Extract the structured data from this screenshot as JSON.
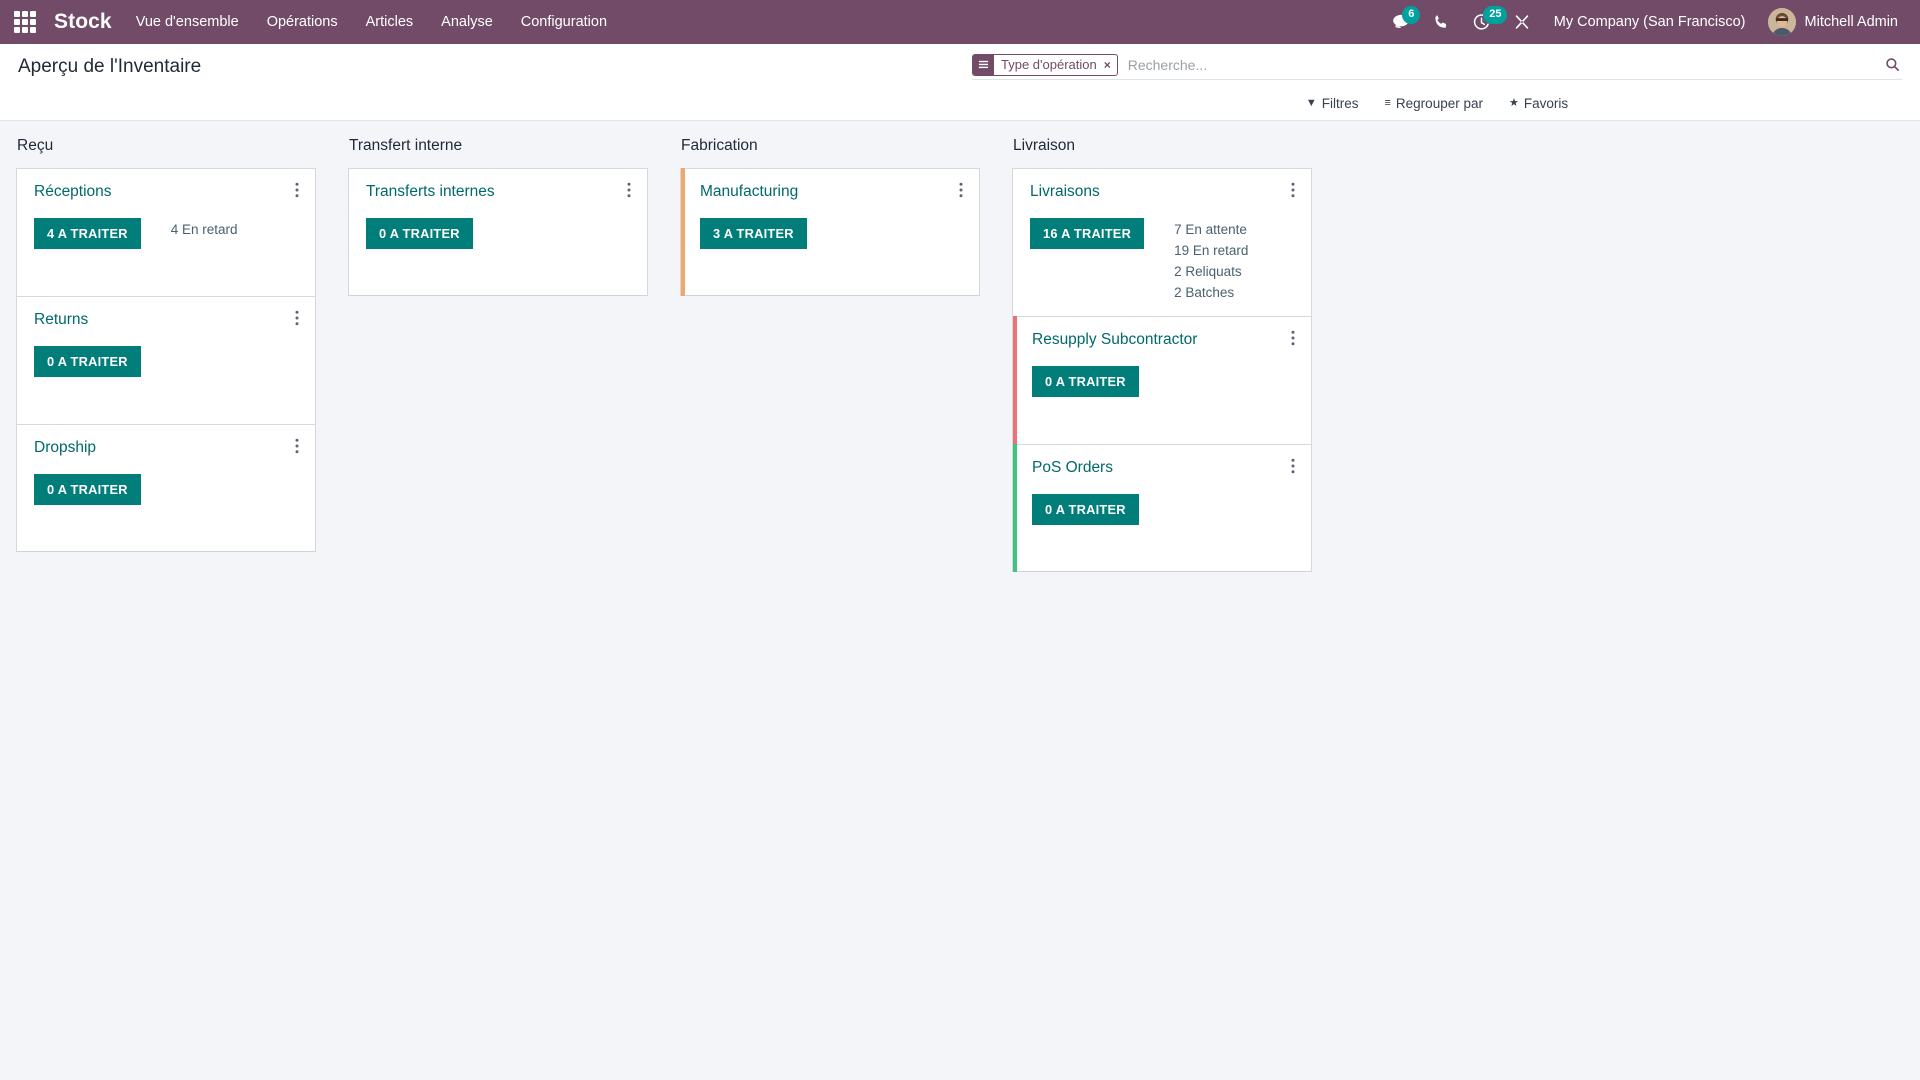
{
  "navbar": {
    "apps_icon": "apps-grid-icon",
    "brand": "Stock",
    "menu": [
      {
        "label": "Vue d'ensemble"
      },
      {
        "label": "Opérations"
      },
      {
        "label": "Articles"
      },
      {
        "label": "Analyse"
      },
      {
        "label": "Configuration"
      }
    ],
    "systray": {
      "messages_icon": "chat-bubble-icon",
      "messages_count": "6",
      "phone_icon": "phone-icon",
      "activities_icon": "clock-icon",
      "activities_count": "25",
      "debug_icon": "tools-icon"
    },
    "company": "My Company (San Francisco)",
    "user": "Mitchell Admin",
    "avatar_icon": "user-avatar"
  },
  "control_panel": {
    "title": "Aperçu de l'Inventaire",
    "search": {
      "facet_icon": "list-bars-icon",
      "facet_label": "Type d'opération",
      "facet_close": "×",
      "placeholder": "Recherche...",
      "value": "",
      "magnifier_icon": "search-icon"
    },
    "filters": [
      {
        "icon": "filter-funnel-icon",
        "glyph": "▼",
        "label": "Filtres"
      },
      {
        "icon": "group-by-icon",
        "glyph": "≡",
        "label": "Regrouper par"
      },
      {
        "icon": "star-icon",
        "glyph": "★",
        "label": "Favoris"
      }
    ]
  },
  "colors": {
    "navbar_purple": "#714b67",
    "button_teal": "#017e79",
    "title_teal": "#00696b",
    "badge_teal": "#00a09d",
    "page_background": "#f4f5f8",
    "accent_orange": "#f0a868",
    "accent_red": "#ef6f77",
    "accent_green": "#3ec47e"
  },
  "kanban": {
    "columns": [
      {
        "title": "Reçu",
        "cards": [
          {
            "title": "Réceptions",
            "menu_icon": "vertical-ellipsis-icon",
            "button": "4 A TRAITER",
            "accent": "",
            "stats": [
              "4 En retard"
            ]
          },
          {
            "title": "Returns",
            "menu_icon": "vertical-ellipsis-icon",
            "button": "0 A TRAITER",
            "accent": "",
            "stats": []
          },
          {
            "title": "Dropship",
            "menu_icon": "vertical-ellipsis-icon",
            "button": "0 A TRAITER",
            "accent": "",
            "stats": []
          }
        ]
      },
      {
        "title": "Transfert interne",
        "cards": [
          {
            "title": "Transferts internes",
            "menu_icon": "vertical-ellipsis-icon",
            "button": "0 A TRAITER",
            "accent": "",
            "stats": []
          }
        ]
      },
      {
        "title": "Fabrication",
        "cards": [
          {
            "title": "Manufacturing",
            "menu_icon": "vertical-ellipsis-icon",
            "button": "3 A TRAITER",
            "accent": "#f0a868",
            "stats": []
          }
        ]
      },
      {
        "title": "Livraison",
        "cards": [
          {
            "title": "Livraisons",
            "menu_icon": "vertical-ellipsis-icon",
            "button": "16 A TRAITER",
            "accent": "",
            "stats": [
              "7 En attente",
              "19 En retard",
              "2 Reliquats",
              "2 Batches"
            ]
          },
          {
            "title": "Resupply Subcontractor",
            "menu_icon": "vertical-ellipsis-icon",
            "button": "0 A TRAITER",
            "accent": "#ef6f77",
            "stats": []
          },
          {
            "title": "PoS Orders",
            "menu_icon": "vertical-ellipsis-icon",
            "button": "0 A TRAITER",
            "accent": "#3ec47e",
            "stats": []
          }
        ]
      }
    ]
  }
}
